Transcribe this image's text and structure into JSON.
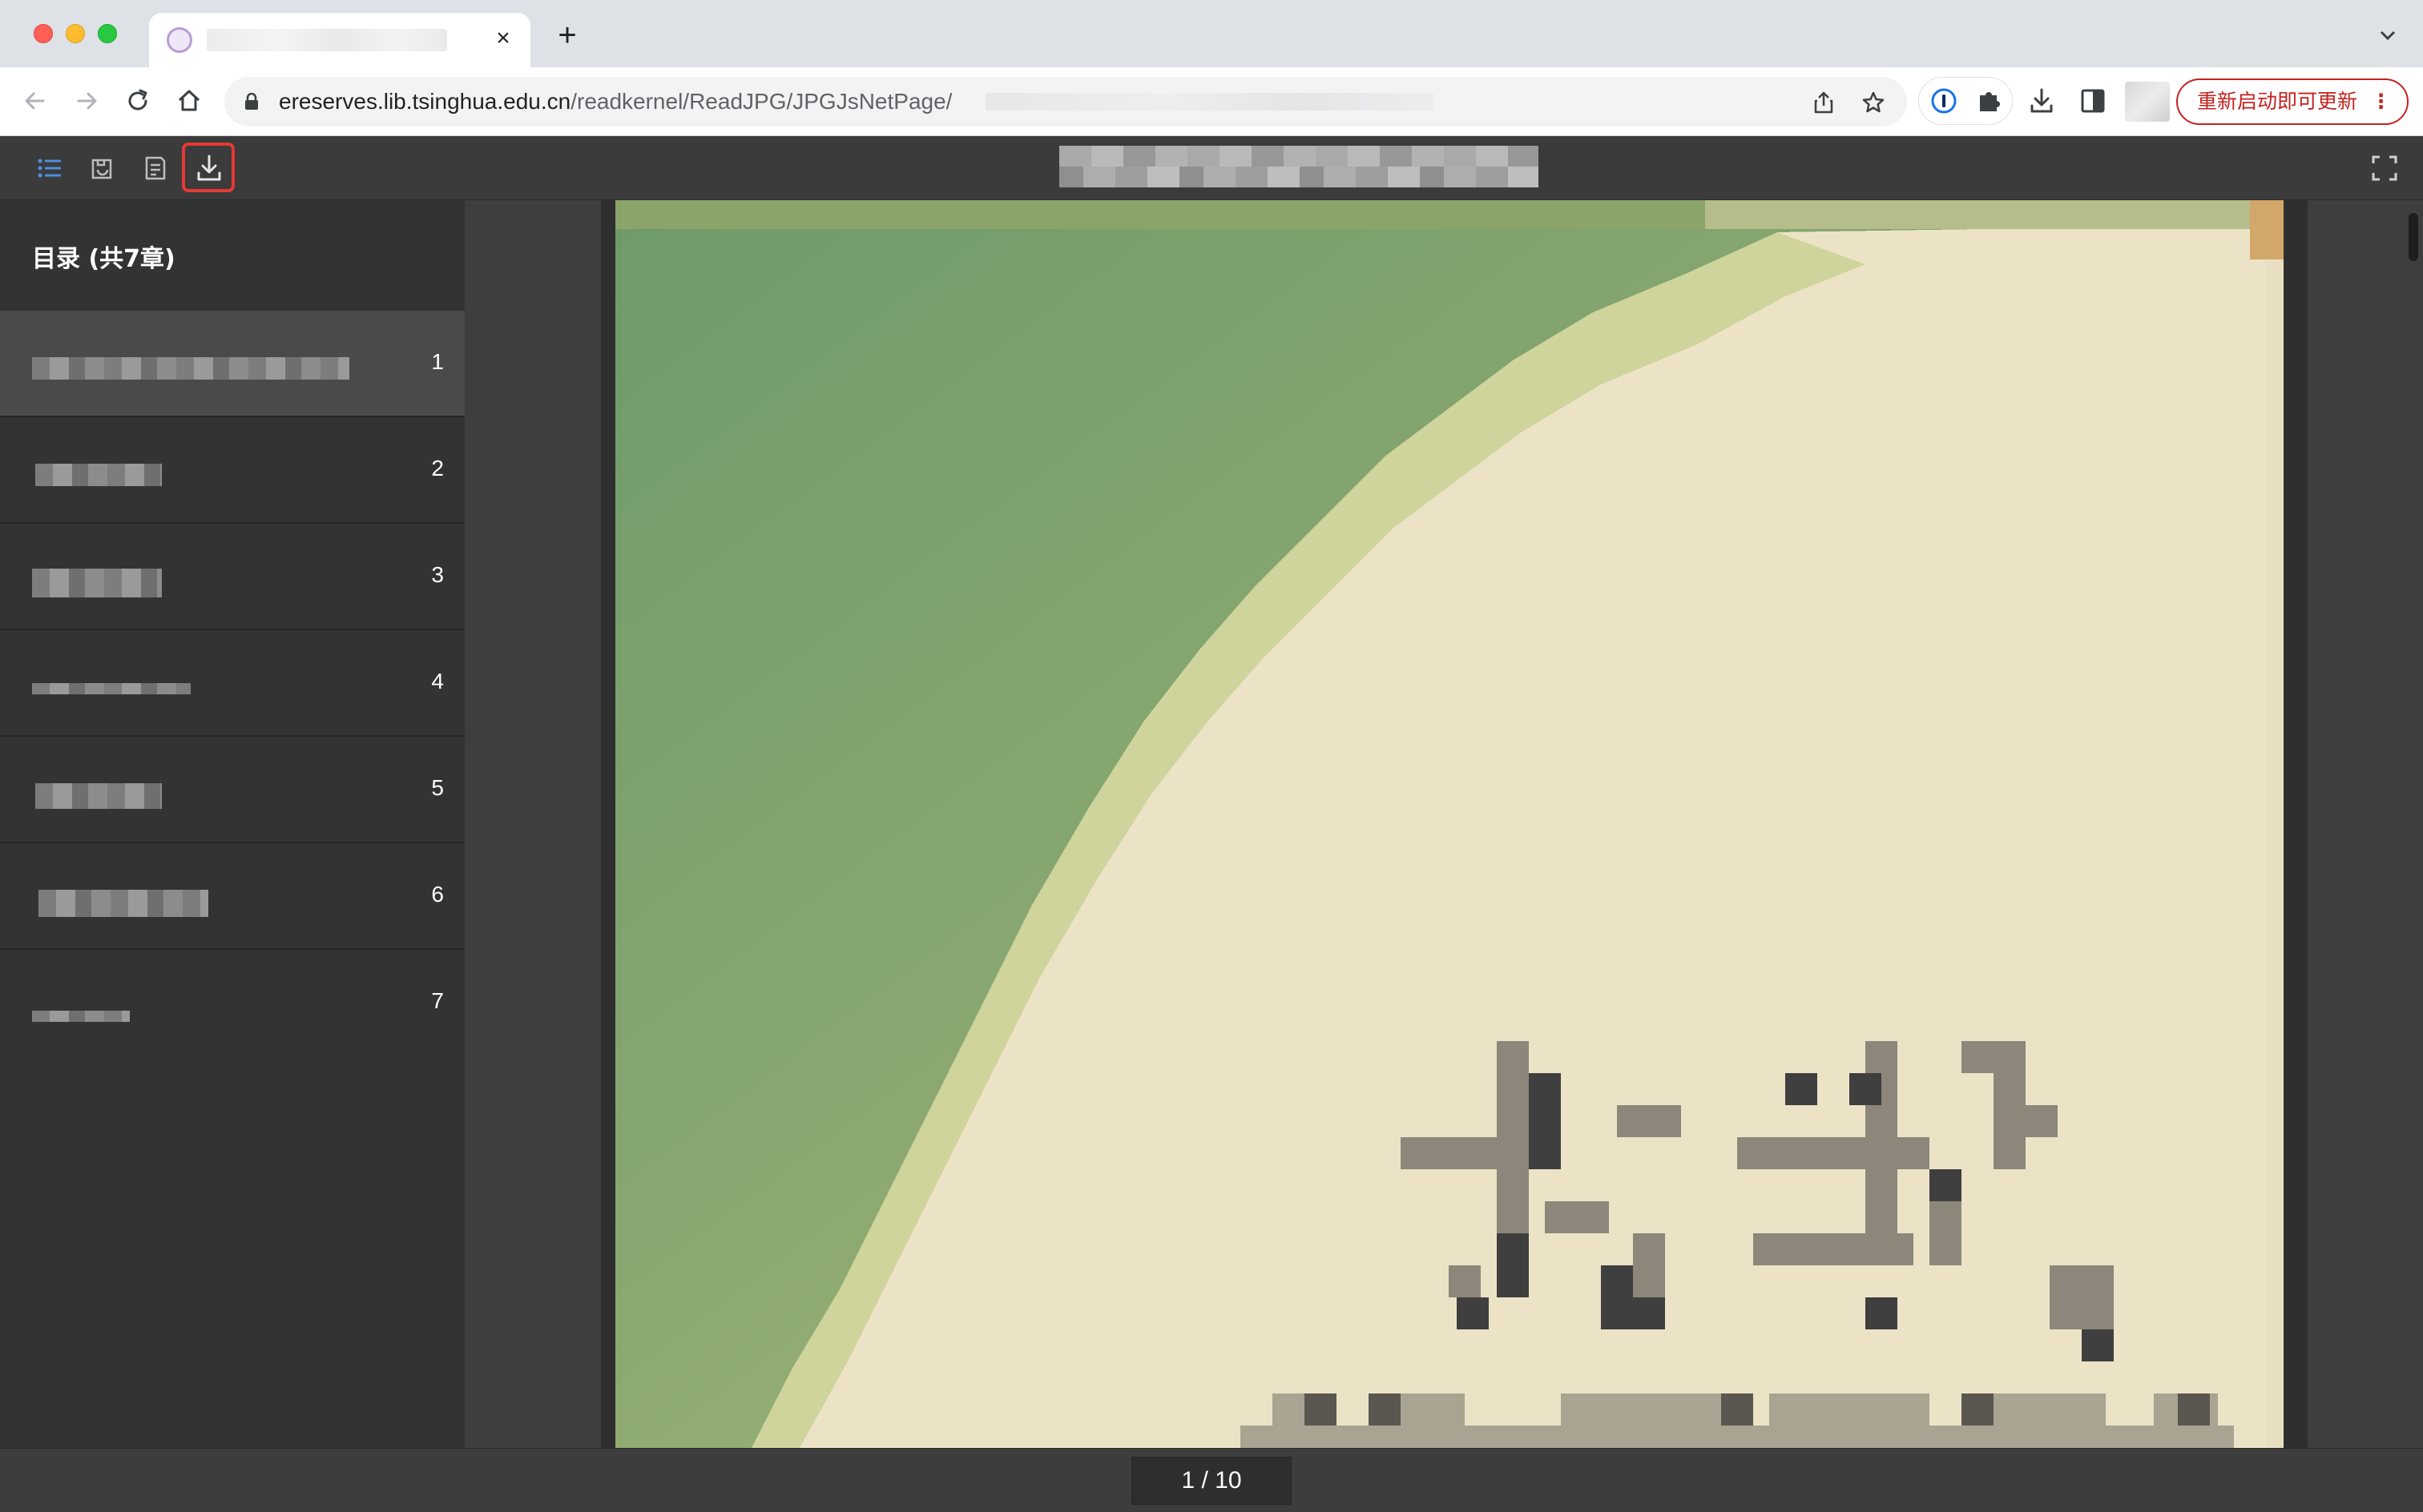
{
  "browser": {
    "tab": {
      "close_glyph": "×"
    },
    "newtab_glyph": "+",
    "url": {
      "host": "ereserves.lib.tsinghua.edu.cn",
      "path": "/readkernel/ReadJPG/JPGJsNetPage/"
    },
    "update_button": {
      "label": "重新启动即可更新",
      "menu_glyph": "⋮"
    },
    "icons": {
      "back": "arrow-left-icon",
      "forward": "arrow-right-icon",
      "reload": "reload-icon",
      "home": "home-icon",
      "lock": "lock-icon",
      "share": "share-icon",
      "bookmark": "star-icon",
      "password_manager": "password-manager-icon",
      "extensions": "puzzle-icon",
      "downloads": "download-icon",
      "side_panel": "side-panel-icon"
    }
  },
  "reader": {
    "toolbar": {
      "toc_icon": "list-icon",
      "thumbnail_icon": "thumbnail-icon",
      "notes_icon": "notes-icon",
      "download_icon": "download-icon",
      "fullscreen_icon": "fullscreen-icon"
    },
    "toc": {
      "title": "目录 (共7章)",
      "items": [
        {
          "number": "1",
          "active": true
        },
        {
          "number": "2",
          "active": false
        },
        {
          "number": "3",
          "active": false
        },
        {
          "number": "4",
          "active": false
        },
        {
          "number": "5",
          "active": false
        },
        {
          "number": "6",
          "active": false
        },
        {
          "number": "7",
          "active": false
        }
      ]
    },
    "pagination": {
      "indicator": "1 / 10",
      "current": 1,
      "total": 10
    }
  }
}
